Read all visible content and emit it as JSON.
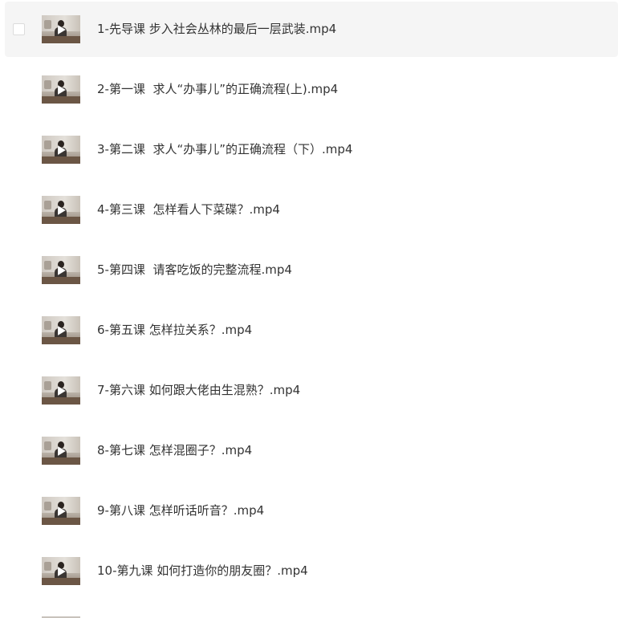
{
  "files": [
    {
      "name": "1-先导课 步入社会丛林的最后一层武装.mp4",
      "selected": true,
      "thumb_icon": "video-thumbnail"
    },
    {
      "name": "2-第一课  求人“办事儿”的正确流程(上).mp4",
      "selected": false,
      "thumb_icon": "video-thumbnail"
    },
    {
      "name": "3-第二课  求人“办事儿”的正确流程（下）.mp4",
      "selected": false,
      "thumb_icon": "video-thumbnail"
    },
    {
      "name": "4-第三课  怎样看人下菜碟？.mp4",
      "selected": false,
      "thumb_icon": "video-thumbnail"
    },
    {
      "name": "5-第四课  请客吃饭的完整流程.mp4",
      "selected": false,
      "thumb_icon": "video-thumbnail"
    },
    {
      "name": "6-第五课 怎样拉关系？.mp4",
      "selected": false,
      "thumb_icon": "video-thumbnail"
    },
    {
      "name": "7-第六课 如何跟大佬由生混熟？.mp4",
      "selected": false,
      "thumb_icon": "video-thumbnail"
    },
    {
      "name": "8-第七课 怎样混圈子？.mp4",
      "selected": false,
      "thumb_icon": "video-thumbnail"
    },
    {
      "name": "9-第八课 怎样听话听音？.mp4",
      "selected": false,
      "thumb_icon": "video-thumbnail"
    },
    {
      "name": "10-第九课 如何打造你的朋友圈？.mp4",
      "selected": false,
      "thumb_icon": "video-thumbnail"
    }
  ],
  "colors": {
    "selected_row_bg": "#f5f5f5",
    "text": "#333333",
    "checkbox_border": "#dcdcdc"
  }
}
